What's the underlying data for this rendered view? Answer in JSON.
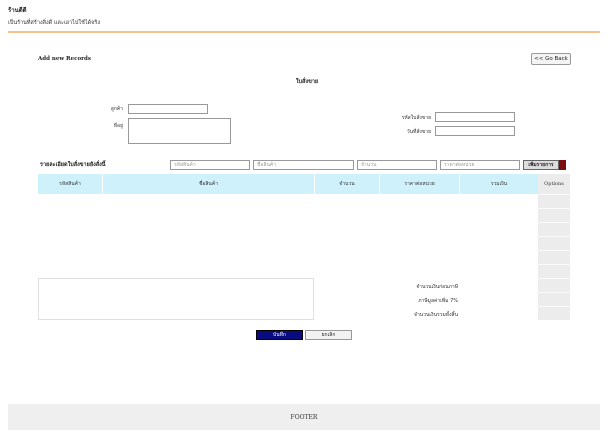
{
  "header": {
    "brand": "ร้านดีดี",
    "tagline": "เป็นร้านที่สร้างสิ่งดี และเอาไปใช้ได้จริง"
  },
  "section": {
    "title": "Add new Records",
    "go_back": "<< Go Back"
  },
  "document": {
    "title": "ใบสั่งขาย"
  },
  "form": {
    "customer_label": "ลูกค้า",
    "customer_value": "",
    "address_label": "ที่อยู่",
    "address_value": "",
    "order_code_label": "รหัสใบสั่งขาย",
    "order_code_value": "",
    "order_date_label": "วันที่สั่งขาย",
    "order_date_value": ""
  },
  "detail_entry": {
    "label": "รายละเอียดใบสั่งขายยังสั่งนี้",
    "product_code_placeholder": "รหัสสินค้า",
    "product_name_placeholder": "ชื่อสินค้า",
    "quantity_placeholder": "จำนวน",
    "unit_price_placeholder": "ราคาต่อหน่วย",
    "add_button": "เพิ่มรายการ"
  },
  "table": {
    "headers": [
      "รหัสสินค้า",
      "ชื่อสินค้า",
      "จำนวน",
      "ราคาต่อหน่วย",
      "รวมเงิน"
    ],
    "options_header": "Options",
    "rows": []
  },
  "summary": {
    "subtotal_label": "จำนวนเงินก่อนภาษี",
    "vat_label": "ภาษีมูลค่าเพิ่ม 7%",
    "total_label": "จำนวนเงินรวมทั้งสิ้น"
  },
  "actions": {
    "save": "บันทึก",
    "cancel": "ยกเลิก"
  },
  "footer": {
    "text": "FOOTER"
  },
  "colors": {
    "header_line": "#f5c08a",
    "table_header": "#cff1fb",
    "save_button": "#0b0b80",
    "add_accent": "#7a1010"
  }
}
